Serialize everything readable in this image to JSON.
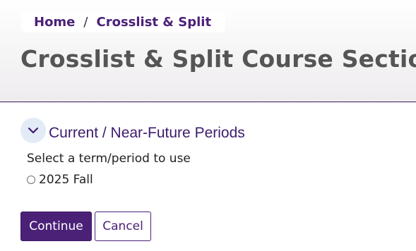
{
  "breadcrumb": {
    "items": [
      {
        "label": "Home"
      },
      {
        "label": "Crosslist & Split"
      }
    ],
    "separator": "/"
  },
  "page": {
    "title": "Crosslist & Split Course Sections"
  },
  "section": {
    "title": "Current / Near-Future Periods",
    "expanded": true,
    "toggle_icon": "chevron-down-icon"
  },
  "form": {
    "prompt": "Select a term/period to use",
    "options": [
      {
        "label": "2025 Fall",
        "selected": false
      }
    ]
  },
  "actions": {
    "continue_label": "Continue",
    "cancel_label": "Cancel"
  },
  "colors": {
    "brand_purple": "#4b2178",
    "title_gray": "#555555",
    "toggle_bg": "#e3ebf7",
    "divider": "#3d1b5c"
  }
}
